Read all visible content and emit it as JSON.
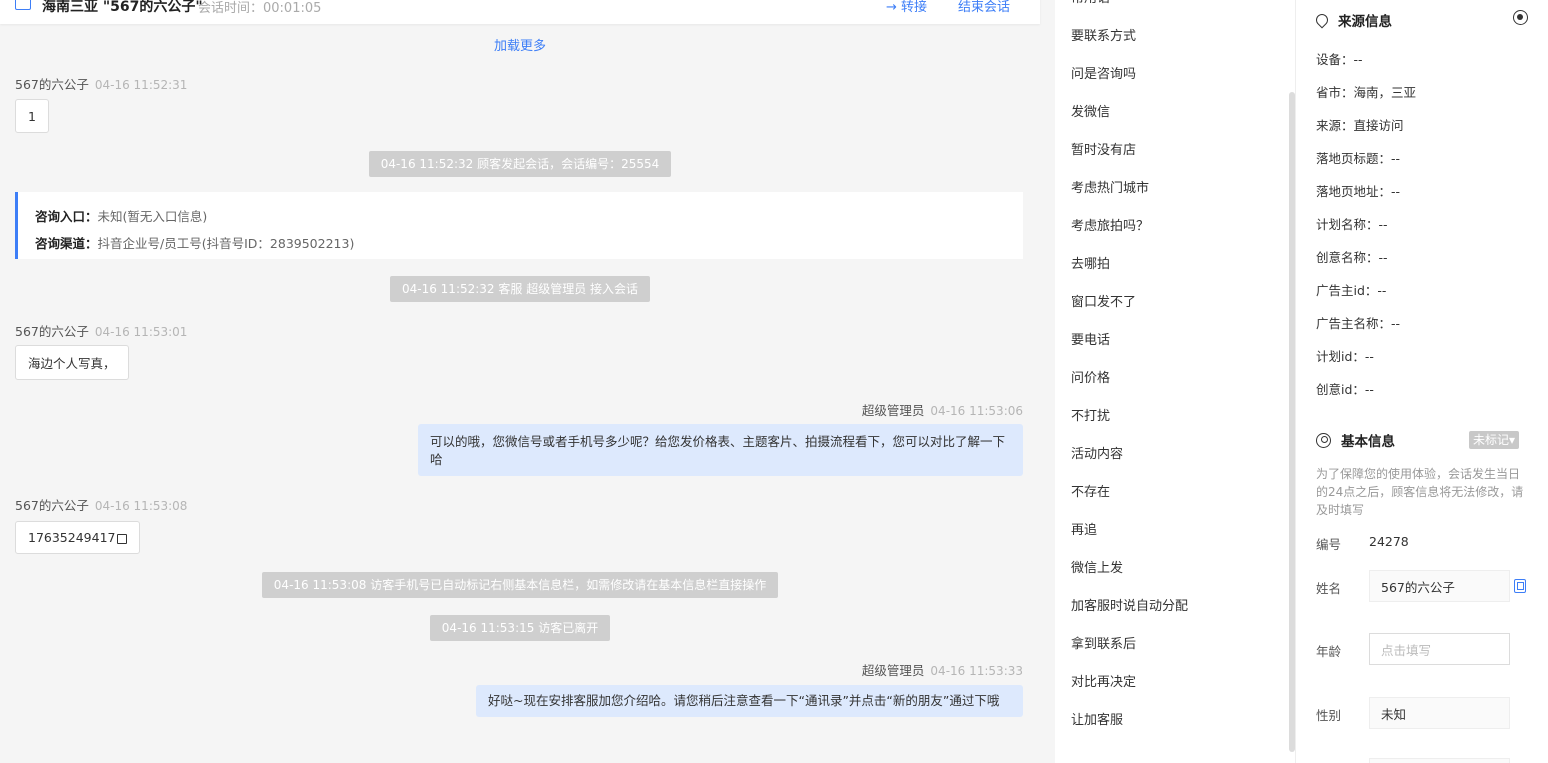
{
  "header": {
    "title": "海南三亚 \"567的六公子\"",
    "session_time": "会话时间：00:01:05",
    "transfer": "→ 转接",
    "end_session": "结束会话"
  },
  "chat": {
    "load_more": "加载更多",
    "entry": {
      "entry_label": "咨询入口：",
      "entry_value": "未知(暂无入口信息)",
      "channel_label": "咨询渠道：",
      "channel_value": "抖音企业号/员工号(抖音号ID：2839502213)"
    },
    "messages": [
      {
        "sender": "567的六公子",
        "time": "04-16 11:52:31",
        "text": "1"
      },
      {
        "system": "04-16 11:52:32 顾客发起会话，会话编号：25554"
      },
      {
        "system": "04-16 11:52:32 客服 超级管理员 接入会话"
      },
      {
        "sender": "567的六公子",
        "time": "04-16 11:53:01",
        "text": "海边个人写真，"
      },
      {
        "sender": "超级管理员",
        "time": "04-16 11:53:06",
        "text": "可以的哦，您微信号或者手机号多少呢？给您发价格表、主题客片、拍摄流程看下，您可以对比了解一下哈"
      },
      {
        "sender": "567的六公子",
        "time": "04-16 11:53:08",
        "text": "17635249417"
      },
      {
        "system": "04-16 11:53:08 访客手机号已自动标记右侧基本信息栏，如需修改请在基本信息栏直接操作"
      },
      {
        "system": "04-16 11:53:15 访客已离开"
      },
      {
        "sender": "超级管理员",
        "time": "04-16 11:53:33",
        "text": "好哒~现在安排客服加您介绍哈。请您稍后注意查看一下“通讯录”并点击“新的朋友”通过下哦"
      }
    ]
  },
  "quick_replies": [
    "常用语",
    "要联系方式",
    "问是咨询吗",
    "发微信",
    "暂时没有店",
    "考虑热门城市",
    "考虑旅拍吗？",
    "去哪拍",
    "窗口发不了",
    "要电话",
    "问价格",
    "不打扰",
    "活动内容",
    "不存在",
    "再追",
    "微信上发",
    "加客服时说自动分配",
    "拿到联系后",
    "对比再决定",
    "让加客服"
  ],
  "source_info": {
    "title": "来源信息",
    "rows": [
      "设备：--",
      "省市：海南，三亚",
      "来源：直接访问",
      "落地页标题：--",
      "落地页地址：--",
      "计划名称：--",
      "创意名称：--",
      "广告主id：--",
      "广告主名称：--",
      "计划id：--",
      "创意id：--"
    ]
  },
  "basic_info": {
    "title": "基本信息",
    "tag": "未标记▾",
    "notice": "为了保障您的使用体验，会话发生当日的24点之后，顾客信息将无法修改，请及时填写",
    "id_label": "编号",
    "id_value": "24278",
    "name_label": "姓名",
    "name_value": "567的六公子",
    "age_label": "年龄",
    "age_placeholder": "点击填写",
    "gender_label": "性别",
    "gender_value": "未知"
  }
}
